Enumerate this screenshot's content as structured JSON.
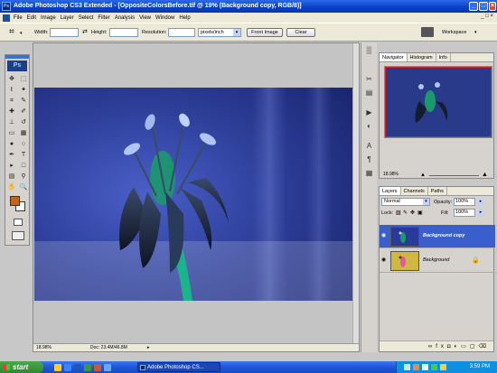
{
  "window": {
    "title": "Adobe Photoshop CS3 Extended - [OppositeColorsBefore.tif @ 19% (Background copy, RGB/8)]",
    "app_icon": "Ps"
  },
  "menu": [
    "File",
    "Edit",
    "Image",
    "Layer",
    "Select",
    "Filter",
    "Analysis",
    "View",
    "Window",
    "Help"
  ],
  "options_bar": {
    "width_label": "Width:",
    "height_label": "Height:",
    "resolution_label": "Resolution:",
    "resolution_unit": "pixels/inch",
    "front_image_label": "Front Image",
    "clear_label": "Clear",
    "workspace_label": "Workspace"
  },
  "toolbox": {
    "logo": "Ps",
    "foreground_color": "#c0661c",
    "background_color": "#ffffff"
  },
  "document": {
    "zoom": "18.98%",
    "doc_size": "Doc: 23.4M/46.8M"
  },
  "navigator_panel": {
    "tabs": [
      "Navigator",
      "Histogram",
      "Info"
    ],
    "zoom": "18.98%"
  },
  "layers_panel": {
    "tabs": [
      "Layers",
      "Channels",
      "Paths"
    ],
    "blend_mode": "Normal",
    "opacity_label": "Opacity:",
    "opacity_value": "100%",
    "lock_label": "Lock:",
    "fill_label": "Fill:",
    "fill_value": "100%",
    "layers": [
      {
        "name": "Background copy",
        "selected": true
      },
      {
        "name": "Background",
        "selected": false
      }
    ]
  },
  "taskbar": {
    "start_label": "start",
    "task_item": "Adobe Photoshop CS...",
    "clock": "3:59 PM"
  },
  "colors": {
    "title_blue": "#0a3fc4",
    "selection_blue": "#3a5fcd",
    "accent_orange": "#c0661c"
  }
}
